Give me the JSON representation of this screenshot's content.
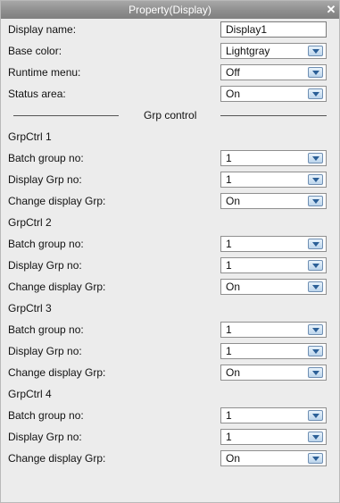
{
  "title": "Property(Display)",
  "close_label": "✕",
  "display_name": {
    "label": "Display name:",
    "value": "Display1"
  },
  "base_color": {
    "label": "Base color:",
    "value": "Lightgray"
  },
  "runtime_menu": {
    "label": "Runtime menu:",
    "value": "Off"
  },
  "status_area": {
    "label": "Status area:",
    "value": "On"
  },
  "grp_control_heading": "Grp control",
  "groups": [
    {
      "title": "GrpCtrl 1",
      "batch": {
        "label": "Batch group no:",
        "value": "1"
      },
      "display": {
        "label": "Display Grp no:",
        "value": "1"
      },
      "change": {
        "label": "Change display Grp:",
        "value": "On"
      }
    },
    {
      "title": "GrpCtrl 2",
      "batch": {
        "label": "Batch group no:",
        "value": "1"
      },
      "display": {
        "label": "Display Grp no:",
        "value": "1"
      },
      "change": {
        "label": "Change display Grp:",
        "value": "On"
      }
    },
    {
      "title": "GrpCtrl 3",
      "batch": {
        "label": "Batch group no:",
        "value": "1"
      },
      "display": {
        "label": "Display Grp no:",
        "value": "1"
      },
      "change": {
        "label": "Change display Grp:",
        "value": "On"
      }
    },
    {
      "title": "GrpCtrl 4",
      "batch": {
        "label": "Batch group no:",
        "value": "1"
      },
      "display": {
        "label": "Display Grp no:",
        "value": "1"
      },
      "change": {
        "label": "Change display Grp:",
        "value": "On"
      }
    }
  ]
}
